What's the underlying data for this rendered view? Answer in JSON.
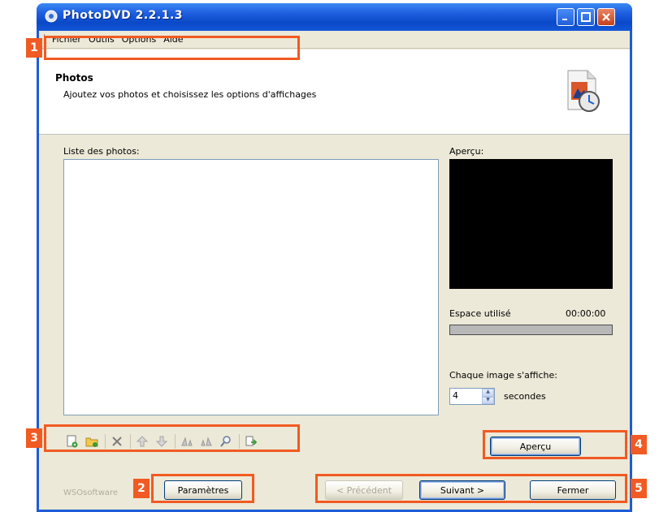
{
  "window": {
    "title": "PhotoDVD 2.2.1.3"
  },
  "menu": {
    "items": [
      "Fichier",
      "Outils",
      "Options",
      "Aide"
    ]
  },
  "header": {
    "title": "Photos",
    "subtitle": "Ajoutez vos photos et choisissez les options d'affichages"
  },
  "photos": {
    "list_label": "Liste des photos:"
  },
  "preview": {
    "label": "Aperçu:"
  },
  "space": {
    "label": "Espace utilisé",
    "time": "00:00:00",
    "fraction_used": 0
  },
  "display": {
    "label": "Chaque image s'affiche:",
    "seconds_value": "4",
    "unit": "secondes"
  },
  "toolbar": {
    "icons": [
      "add-photo-icon",
      "add-folder-icon",
      "delete-icon",
      "move-up-icon",
      "move-down-icon",
      "rotate-left-icon",
      "rotate-right-icon",
      "zoom-icon",
      "export-icon"
    ]
  },
  "buttons": {
    "apercu": "Aperçu",
    "parametres": "Paramètres",
    "precedent": "< Précédent",
    "suivant": "Suivant >",
    "fermer": "Fermer"
  },
  "footer": {
    "brand": "WSOsoftware"
  },
  "callouts": [
    "1",
    "2",
    "3",
    "4",
    "5"
  ],
  "colors": {
    "accent": "#f15a22",
    "titlebar": "#0a49c8",
    "window_bg": "#ece9d8",
    "preview_bg": "#000000"
  }
}
